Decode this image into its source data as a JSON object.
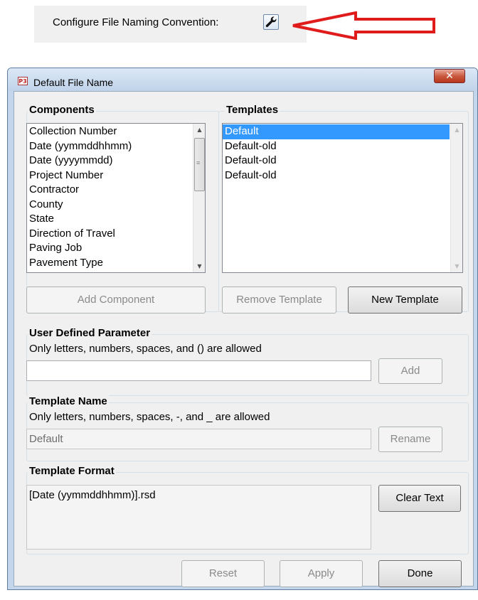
{
  "banner": {
    "label": "Configure File Naming Convention:",
    "button_icon": "wrench-icon",
    "annotation": "red-arrow-pointing-left",
    "arrow_color": "#e01b1b"
  },
  "window": {
    "title": "Default File Name",
    "icon": "p3-app-icon",
    "icon_text": "P3",
    "close_glyph": "✕"
  },
  "components": {
    "title": "Components",
    "items": [
      "Collection Number",
      "Date (yymmddhhmm)",
      "Date (yyyymmdd)",
      "Project Number",
      "Contractor",
      "County",
      "State",
      "Direction of Travel",
      "Paving Job",
      "Pavement Type"
    ],
    "add_button": "Add Component"
  },
  "templates": {
    "title": "Templates",
    "items": [
      "Default",
      "Default-old",
      "Default-old",
      "Default-old"
    ],
    "selected_index": 0,
    "remove_button": "Remove Template",
    "new_button": "New Template"
  },
  "user_param": {
    "title": "User Defined Parameter",
    "description": "Only letters, numbers, spaces, and () are allowed",
    "value": "",
    "add_button": "Add"
  },
  "template_name": {
    "title": "Template Name",
    "description": "Only letters, numbers, spaces, -, and _ are allowed",
    "value": "Default",
    "rename_button": "Rename"
  },
  "template_format": {
    "title": "Template Format",
    "value": "[Date (yymmddhhmm)].rsd",
    "clear_button": "Clear Text"
  },
  "footer": {
    "reset": "Reset",
    "apply": "Apply",
    "done": "Done"
  }
}
